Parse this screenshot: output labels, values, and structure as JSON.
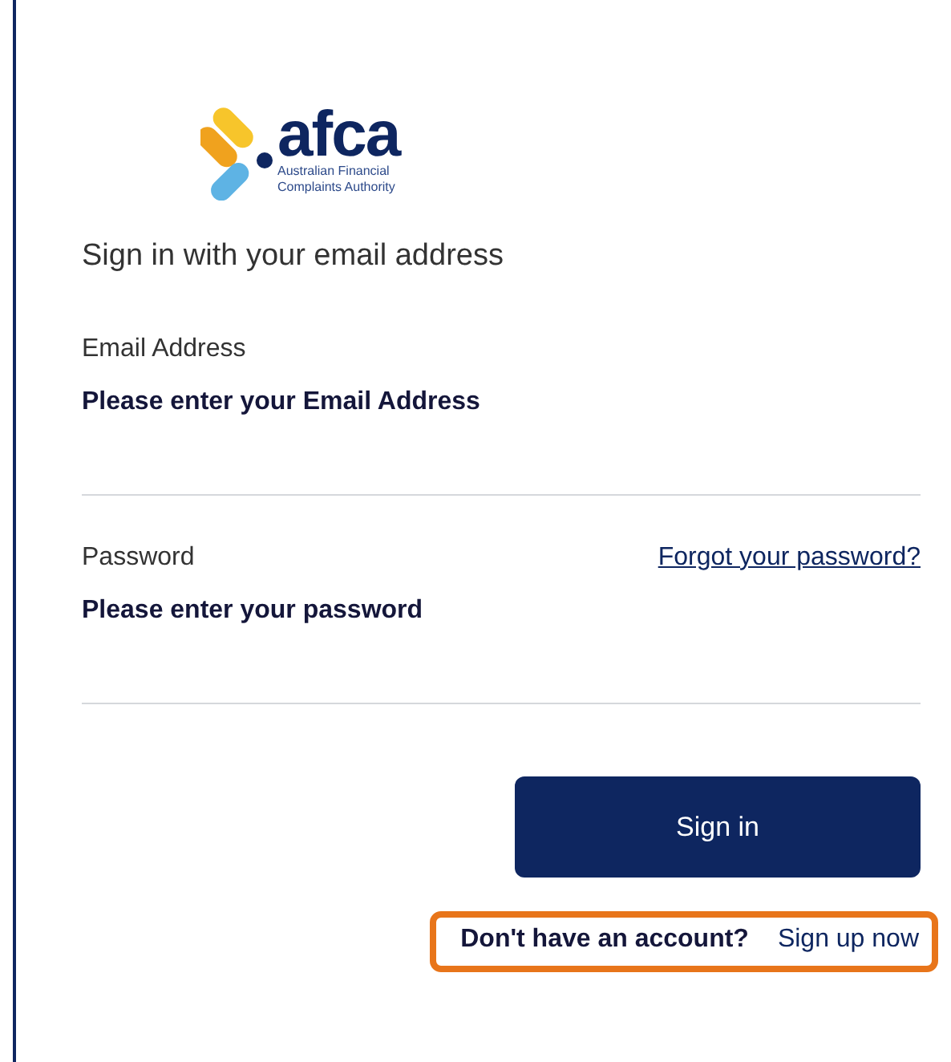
{
  "logo": {
    "name": "afca",
    "subtitle_lines": [
      "Australian Financial",
      "Complaints Authority"
    ]
  },
  "heading": "Sign in with your email address",
  "fields": [
    {
      "label": "Email Address",
      "placeholder": "Please enter your Email Address"
    },
    {
      "label": "Password",
      "placeholder": "Please enter your password",
      "link": "Forgot your password?"
    }
  ],
  "submit": "Sign in",
  "signup": {
    "prompt": "Don't have an account?",
    "link": "Sign up now",
    "highlighted": true
  }
}
